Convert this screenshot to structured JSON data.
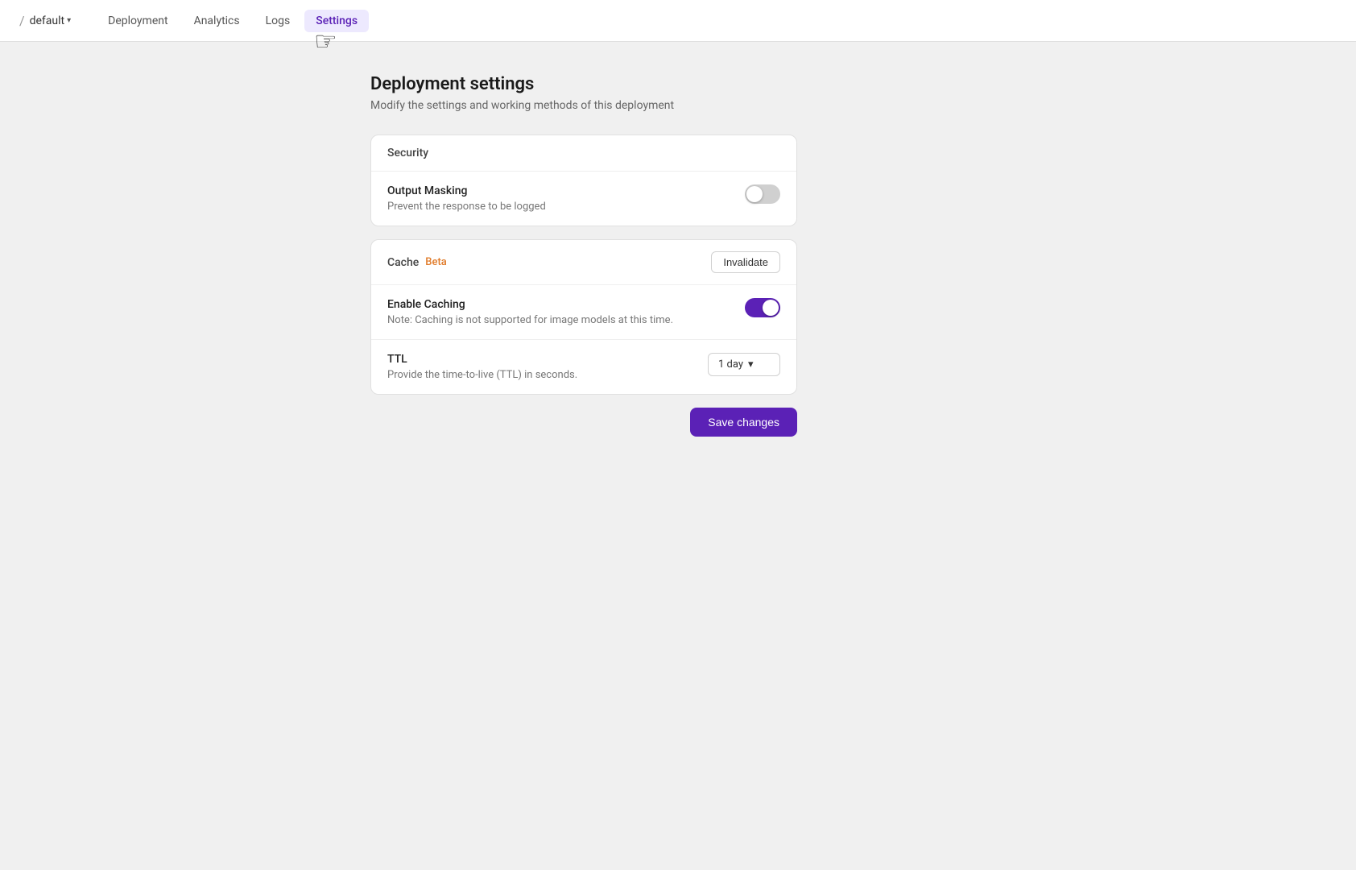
{
  "topbar": {
    "slash": "/",
    "breadcrumb_label": "default",
    "chevron": "▾",
    "nav_tabs": [
      {
        "id": "deployment",
        "label": "Deployment",
        "active": false
      },
      {
        "id": "analytics",
        "label": "Analytics",
        "active": false
      },
      {
        "id": "logs",
        "label": "Logs",
        "active": false
      },
      {
        "id": "settings",
        "label": "Settings",
        "active": true
      }
    ]
  },
  "page": {
    "title": "Deployment settings",
    "subtitle": "Modify the settings and working methods of this deployment"
  },
  "security_card": {
    "header": "Security",
    "output_masking": {
      "label": "Output Masking",
      "description": "Prevent the response to be logged",
      "enabled": false
    }
  },
  "cache_card": {
    "header": "Cache",
    "beta_label": "Beta",
    "invalidate_button": "Invalidate",
    "enable_caching": {
      "label": "Enable Caching",
      "description": "Note: Caching is not supported for image models at this time.",
      "enabled": true
    },
    "ttl": {
      "label": "TTL",
      "description": "Provide the time-to-live (TTL) in seconds.",
      "selected": "1 day",
      "chevron": "▾"
    }
  },
  "footer": {
    "save_button": "Save changes"
  },
  "colors": {
    "accent": "#5b21b6",
    "beta": "#e07b2a"
  }
}
